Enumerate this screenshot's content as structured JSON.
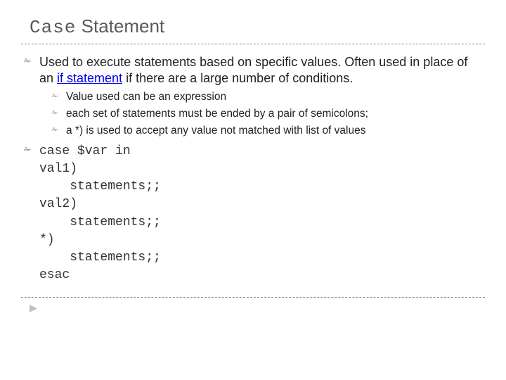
{
  "title": {
    "code": "Case",
    "rest": " Statement"
  },
  "items": [
    {
      "pre": "Used to execute statements based on specific values. Often used in place of an ",
      "link": "if statement",
      "post": " if there are a large number of conditions.",
      "sub": [
        "Value used can be an expression",
        "each set of statements must be ended by a pair of semicolons;",
        "a *) is used to accept any value not matched with list of values"
      ]
    }
  ],
  "code": "case $var in\nval1)\n    statements;;\nval2)\n    statements;;\n*)\n    statements;;\nesac"
}
